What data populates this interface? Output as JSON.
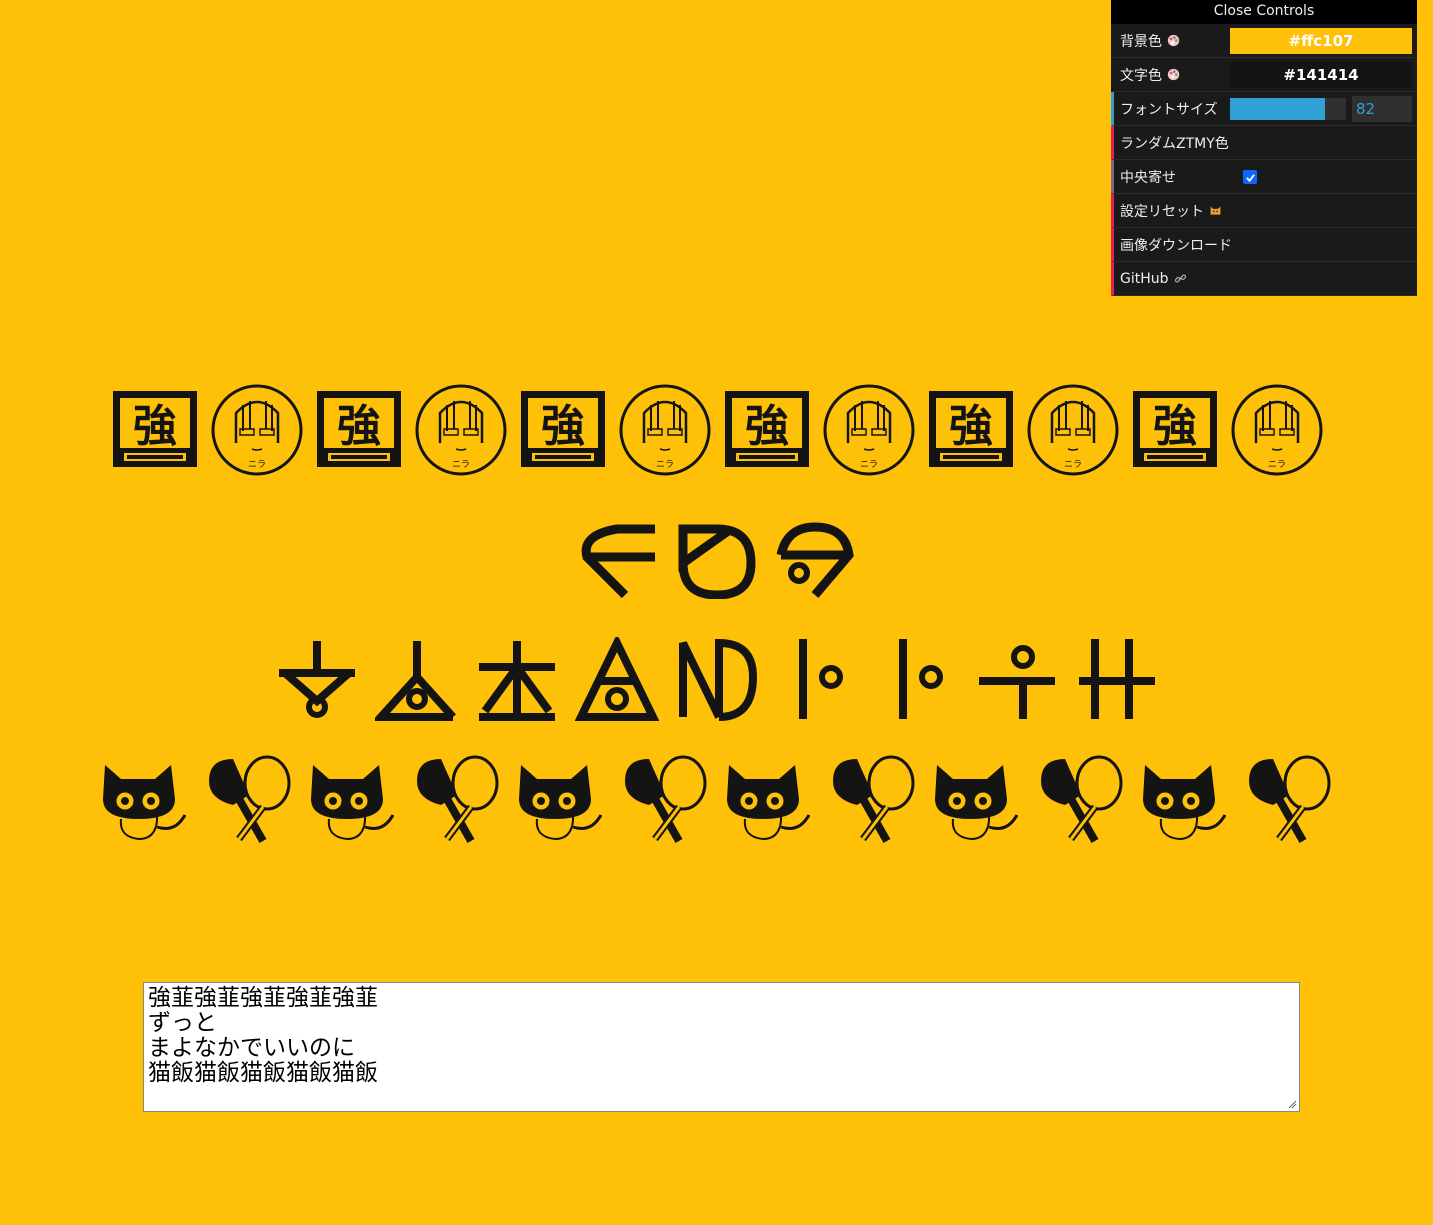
{
  "panel": {
    "close_label": "Close Controls",
    "bg_color_label": "背景色",
    "bg_color_value": "#ffc107",
    "text_color_label": "文字色",
    "text_color_value": "#141414",
    "font_size_label": "フォントサイズ",
    "font_size_value": "82",
    "font_size_fraction": 0.82,
    "random_label": "ランダムZTMY色",
    "center_label": "中央寄せ",
    "center_checked": true,
    "reset_label": "設定リセット",
    "download_label": "画像ダウンロード",
    "github_label": "GitHub"
  },
  "input": {
    "lines": [
      "強韮強韮強韮強韮強韮",
      "ずっと",
      "まよなかでいいのに",
      "猫飯猫飯猫飯猫飯猫飯"
    ]
  },
  "display": {
    "line1_chars": "強韮強韮強韮強韮強韮",
    "line2_chars": "ずっと",
    "line3_chars": "まよなかでいいのに",
    "line4_chars": "猫飯猫飯猫飯猫飯猫飯"
  },
  "colors": {
    "background": "#ffc107",
    "text": "#141414",
    "accent": "#2fa1d6",
    "func": "#e61d5f"
  }
}
